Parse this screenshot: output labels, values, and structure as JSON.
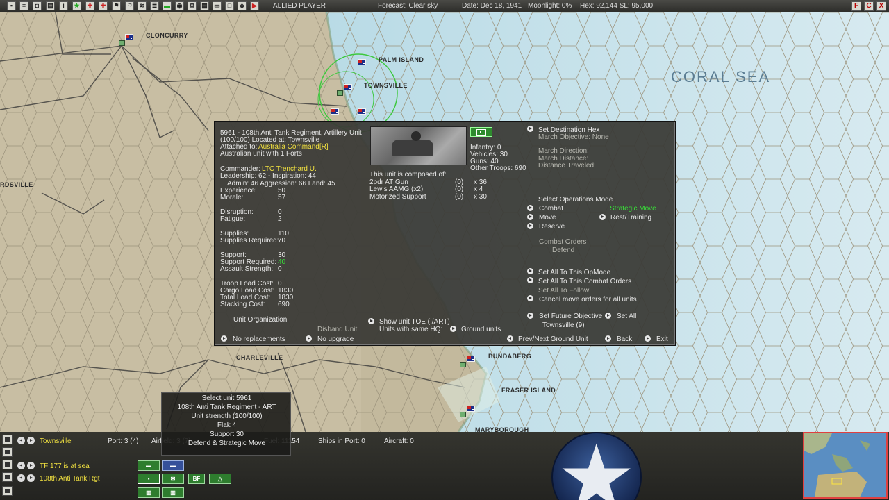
{
  "topbar": {
    "player": "ALLIED PLAYER",
    "forecast": "Forecast: Clear sky",
    "date": "Date: Dec 18, 1941",
    "moonlight": "Moonlight: 0%",
    "hex": "Hex: 92,144  SL: 95,000",
    "win_buttons": [
      "F",
      "C",
      "X"
    ]
  },
  "map": {
    "places": [
      "CLONCURRY",
      "PALM ISLAND",
      "TOWNSVILLE",
      "RDSVILLE",
      "CHARLEVILLE",
      "BUNDABERG",
      "FRASER ISLAND",
      "MARYBOROUGH"
    ],
    "sea": "CORAL SEA"
  },
  "unit": {
    "header": [
      "5961 - 108th Anti Tank Regiment, Artillery Unit",
      "(100/100) Located at: Townsville"
    ],
    "attached_label": "Attached to:",
    "attached_value": "Australia Command[R]",
    "forts": "Australian unit with 1 Forts",
    "commander_label": "Commander:",
    "commander_value": "LTC Trenchard U.",
    "leadership": "Leadership: 62 - Inspiration: 44",
    "admin": "Admin: 46  Aggression: 66  Land: 45",
    "stats": [
      {
        "label": "Experience:",
        "value": "50"
      },
      {
        "label": "Morale:",
        "value": "57"
      },
      {
        "label": "Disruption:",
        "value": "0"
      },
      {
        "label": "Fatigue:",
        "value": "2"
      },
      {
        "label": "Supplies:",
        "value": "110"
      },
      {
        "label": "Supplies Required:",
        "value": "70"
      },
      {
        "label": "Support:",
        "value": "30"
      },
      {
        "label": "Support Required:",
        "value": "40"
      },
      {
        "label": "Assault Strength:",
        "value": "0"
      },
      {
        "label": "Troop Load Cost:",
        "value": "0"
      },
      {
        "label": "Cargo Load Cost:",
        "value": "1830"
      },
      {
        "label": "Total Load Cost:",
        "value": "1830"
      },
      {
        "label": "Stacking Cost:",
        "value": "690"
      }
    ],
    "totals": [
      "Infantry: 0",
      "Vehicles: 30",
      "Guns: 40",
      "Other Troops: 690"
    ],
    "composed_title": "This unit is composed of:",
    "composition": [
      {
        "name": "2pdr AT Gun",
        "dmg": "(0)",
        "qty": "x 36"
      },
      {
        "name": "Lewis AAMG (x2)",
        "dmg": "(0)",
        "qty": "x 4"
      },
      {
        "name": "Motorized Support",
        "dmg": "(0)",
        "qty": "x 30"
      }
    ],
    "unit_org": "Unit Organization",
    "disband": "Disband Unit",
    "no_replacements": "No replacements",
    "no_upgrade": "No upgrade",
    "show_toe": "Show unit TOE ( /ART)",
    "same_hq": "Units with same HQ:",
    "ground_units": "Ground units",
    "set_dest": "Set Destination Hex",
    "march_obj": "March Objective: None",
    "march_dir": "March Direction:",
    "march_dist": "March Distance:",
    "dist_trav": "Distance Traveled:",
    "select_ops": "Select Operations Mode",
    "ops_combat": "Combat",
    "ops_strategic": "Strategic Move",
    "ops_move": "Move",
    "ops_rest": "Rest/Training",
    "ops_reserve": "Reserve",
    "combat_orders": "Combat Orders",
    "defend": "Defend",
    "set_all_opmode": "Set All To This OpMode",
    "set_all_combat": "Set All To This Combat Orders",
    "set_all_follow": "Set All To Follow",
    "cancel_move": "Cancel move orders for all units",
    "set_future": "Set Future Objective",
    "set_all": "Set All",
    "future_value": "Townsville (9)",
    "prev_next": "Prev/Next Ground Unit",
    "back": "Back",
    "exit": "Exit"
  },
  "tooltip": [
    "Select unit 5961",
    "108th Anti Tank Regiment - ART",
    "Unit strength (100/100)",
    "Flak 4",
    "Support 30",
    "Defend & Strategic Move"
  ],
  "bottom": {
    "location": "Townsville",
    "port": "Port: 3 (4)",
    "airfield": "Airfield: 3 (7)",
    "fuel": "Fuel: 11154",
    "ships": "Ships in Port: 0",
    "aircraft": "Aircraft: 0",
    "tf": "TF 177 is at sea",
    "unit": "108th Anti Tank Rgt",
    "bf": "BF"
  },
  "colors": {
    "highlight_yellow": "#f0e040",
    "highlight_green": "#38e038",
    "panel_bg": "#3a3a36"
  }
}
